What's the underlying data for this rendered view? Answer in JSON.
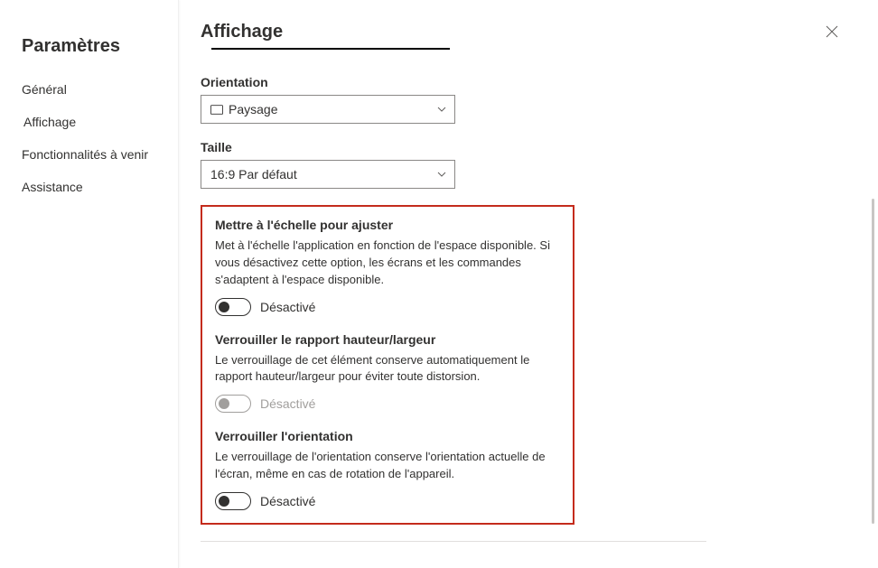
{
  "sidebar": {
    "title": "Paramètres",
    "items": [
      {
        "label": "Général"
      },
      {
        "label": "Affichage"
      },
      {
        "label": "Fonctionnalités à venir"
      },
      {
        "label": "Assistance"
      }
    ],
    "active_index": 1
  },
  "main": {
    "title": "Affichage",
    "orientation": {
      "label": "Orientation",
      "value": "Paysage"
    },
    "size": {
      "label": "Taille",
      "value": "16:9 Par défaut"
    },
    "options": {
      "scale": {
        "title": "Mettre à l'échelle pour ajuster",
        "desc": "Met à l'échelle l'application en fonction de l'espace disponible. Si vous désactivez cette option, les écrans et les commandes s'adaptent à l'espace disponible.",
        "state_label": "Désactivé",
        "on": false,
        "disabled": false
      },
      "lock_ratio": {
        "title": "Verrouiller le rapport hauteur/largeur",
        "desc": "Le verrouillage de cet élément conserve automatiquement le rapport hauteur/largeur pour éviter toute distorsion.",
        "state_label": "Désactivé",
        "on": false,
        "disabled": true
      },
      "lock_orientation": {
        "title": "Verrouiller l'orientation",
        "desc": "Le verrouillage de l'orientation conserve l'orientation actuelle de l'écran, même en cas de rotation de l'appareil.",
        "state_label": "Désactivé",
        "on": false,
        "disabled": false
      }
    }
  }
}
